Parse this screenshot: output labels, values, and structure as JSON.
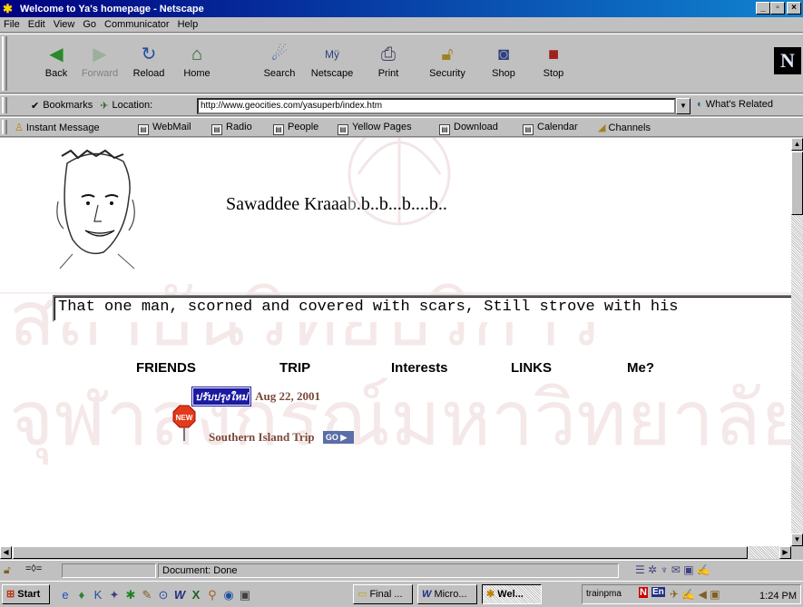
{
  "window": {
    "title": "Welcome to Ya's homepage - Netscape",
    "controls": [
      "_",
      "▫",
      "×"
    ]
  },
  "menu": [
    "File",
    "Edit",
    "View",
    "Go",
    "Communicator",
    "Help"
  ],
  "toolbar": {
    "back": "Back",
    "forward": "Forward",
    "reload": "Reload",
    "home": "Home",
    "search": "Search",
    "netscape": "Netscape",
    "print": "Print",
    "security": "Security",
    "shop": "Shop",
    "stop": "Stop"
  },
  "location": {
    "bookmarks_label": "Bookmarks",
    "location_label": "Location:",
    "url": "http://www.geocities.com/yasuperb/index.htm",
    "related_label": "What's Related"
  },
  "personal_toolbar": [
    "Instant Message",
    "WebMail",
    "Radio",
    "People",
    "Yellow Pages",
    "Download",
    "Calendar",
    "Channels"
  ],
  "page": {
    "greeting": {
      "part1": "Sawaddee",
      "part2": " Kraaa",
      "part3": "b",
      "part4": ".b..b...b....b..",
      "part5": ""
    },
    "marquee_text": "That one man, scorned and covered with scars, Still strove with his",
    "nav": [
      "FRIENDS",
      "TRIP",
      "Interests",
      "LINKS",
      "Me?"
    ],
    "update_badge": "ปรับปรุงใหม่",
    "update_date": "Aug 22, 2001",
    "new_sign": "NEW",
    "trip_link": "Southern Island Trip",
    "go_label": "GO ▶"
  },
  "status": {
    "text": "Document: Done"
  },
  "taskbar": {
    "start": "Start",
    "tasks": [
      "Final ...",
      "Micro...",
      "Wel..."
    ],
    "tray_text": "trainpma",
    "clock": "1:24 PM"
  }
}
